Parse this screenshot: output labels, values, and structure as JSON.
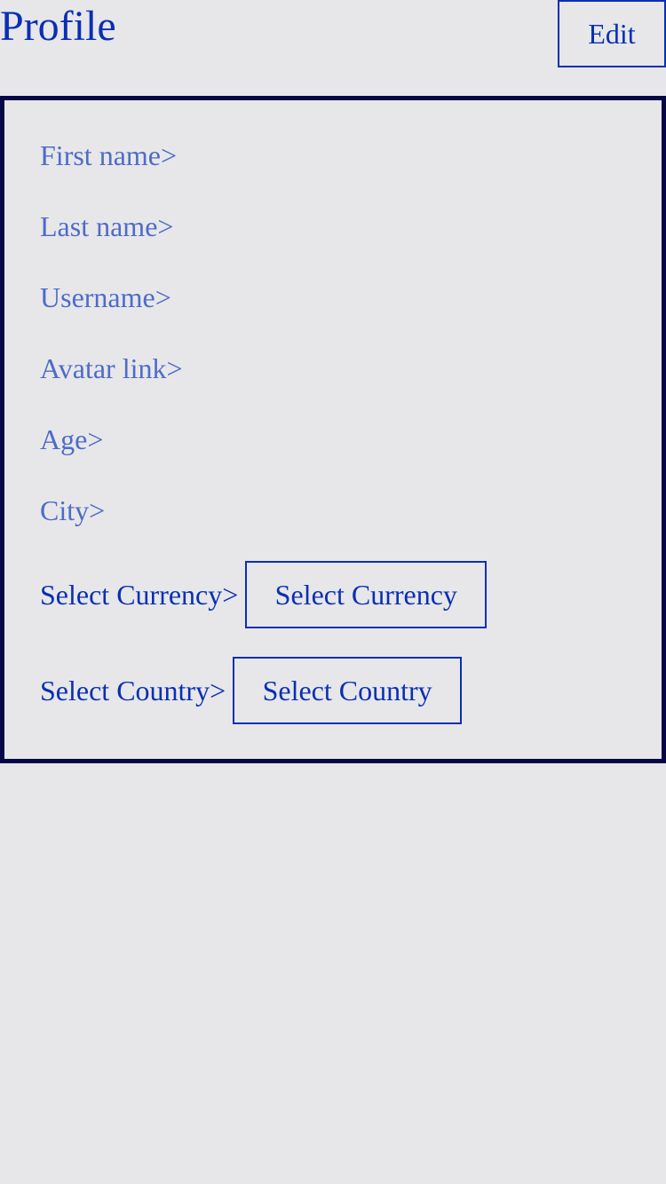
{
  "header": {
    "title": "Profile",
    "edit_label": "Edit"
  },
  "fields": {
    "first_name": "First name>",
    "last_name": "Last name>",
    "username": "Username>",
    "avatar_link": "Avatar link>",
    "age": "Age>",
    "city": "City>"
  },
  "currency": {
    "label": "Select Currency>",
    "button_label": "Select Currency"
  },
  "country": {
    "label": "Select Country>",
    "button_label": "Select Country"
  },
  "colors": {
    "background": "#e7e7e9",
    "primary": "#0a2fb4",
    "field_text": "#4e6bc9",
    "panel_border": "#050747"
  }
}
